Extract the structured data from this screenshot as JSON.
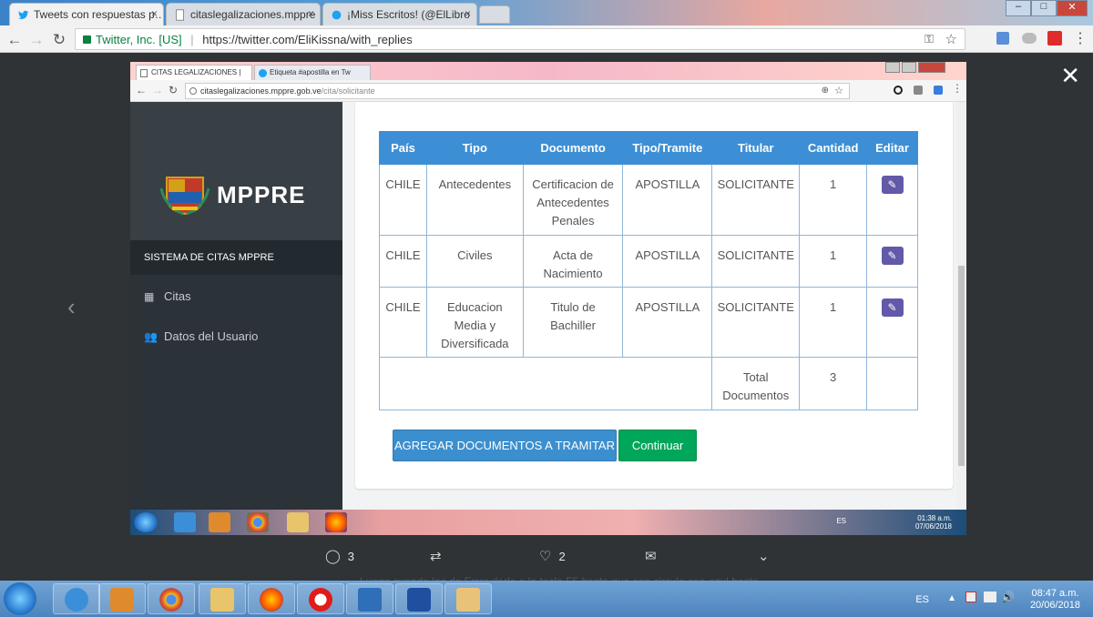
{
  "outer_browser": {
    "tabs": [
      {
        "label": "Tweets con respuestas p…",
        "active": true
      },
      {
        "label": "citaslegalizaciones.mppre",
        "active": false
      },
      {
        "label": "¡Miss Escritos!  (@ElLibro",
        "active": false
      }
    ],
    "secure_label": "Twitter, Inc. [US]",
    "url": "https://twitter.com/EliKissna/with_replies"
  },
  "inner_browser": {
    "tabs": [
      {
        "label": "CITAS LEGALIZACIONES |",
        "active": true
      },
      {
        "label": "Etiqueta #apostilla en Tw",
        "active": false
      }
    ],
    "url_host": "citaslegalizaciones.mppre.gob.ve",
    "url_path": "/cita/solicitante"
  },
  "sidebar": {
    "brand": "MPPRE",
    "system_title": "SISTEMA DE CITAS MPPRE",
    "items": [
      {
        "label": "Citas",
        "icon": "calendar-icon"
      },
      {
        "label": "Datos del Usuario",
        "icon": "users-icon"
      }
    ]
  },
  "table": {
    "headers": [
      "País",
      "Tipo",
      "Documento",
      "Tipo/Tramite",
      "Titular",
      "Cantidad",
      "Editar"
    ],
    "rows": [
      {
        "pais": "CHILE",
        "tipo": "Antecedentes",
        "documento": "Certificacion de Antecedentes Penales",
        "tramite": "APOSTILLA",
        "titular": "SOLICITANTE",
        "cantidad": "1"
      },
      {
        "pais": "CHILE",
        "tipo": "Civiles",
        "documento": "Acta de Nacimiento",
        "tramite": "APOSTILLA",
        "titular": "SOLICITANTE",
        "cantidad": "1"
      },
      {
        "pais": "CHILE",
        "tipo": "Educacion Media y Diversificada",
        "documento": "Titulo de Bachiller",
        "tramite": "APOSTILLA",
        "titular": "SOLICITANTE",
        "cantidad": "1"
      }
    ],
    "total_label": "Total Documentos",
    "total_value": "3"
  },
  "buttons": {
    "add": "AGREGAR DOCUMENTOS A TRAMITAR",
    "continue": "Continuar"
  },
  "inner_taskbar": {
    "lang": "ES",
    "time": "01:38 a.m.",
    "date": "07/06/2018"
  },
  "tweet_actions": {
    "replies": "3",
    "likes": "2"
  },
  "peek_text": "Luego cuando les de Error darle a la tecla F5 hasta que ese circulo sea azul hasta",
  "taskbar": {
    "lang": "ES",
    "time": "08:47 a.m.",
    "date": "20/06/2018"
  },
  "colors": {
    "table_header": "#3d8fd5",
    "edit_button": "#6259a8",
    "add_button": "#3c8fce",
    "continue_button": "#00a65a",
    "sidebar": "#2b3238"
  }
}
